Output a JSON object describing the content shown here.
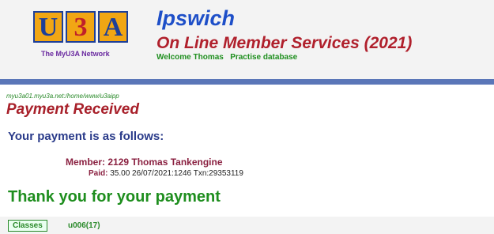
{
  "logo": {
    "letters": [
      "U",
      "3",
      "A"
    ],
    "network_text": "The MyU3A Network"
  },
  "header": {
    "title": "Ipswich",
    "subtitle": "On Line Member Services (2021)",
    "welcome": "Welcome Thomas",
    "practise": "Practise",
    "database": "database"
  },
  "page": {
    "path": "myu3a01.myu3a.net:/home/www/u3aipp",
    "heading": "Payment Received",
    "intro": "Your payment is as follows:",
    "member": "Member: 2129 Thomas Tankengine",
    "paid_label": "Paid:",
    "paid_details": "35.00 26/07/2021:1246 Txn:29353119",
    "thank_you": "Thank you for your payment"
  },
  "footer": {
    "classes_label": "Classes",
    "course_code": "u006(17)"
  },
  "colors": {
    "logo_orange": "#f1a614",
    "logo_blue": "#1d3f99",
    "title_blue": "#1e4fc8",
    "subtitle_red": "#b0202c",
    "green": "#1e8e1e",
    "rule_blue": "#5a76b8"
  }
}
